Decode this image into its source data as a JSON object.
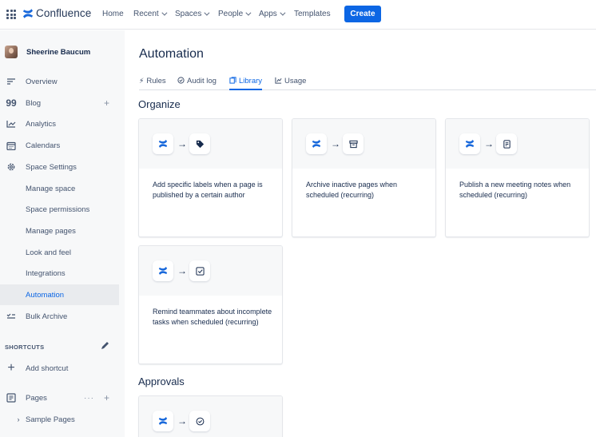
{
  "topnav": {
    "logo_text": "Confluence",
    "items": [
      "Home",
      "Recent",
      "Spaces",
      "People",
      "Apps",
      "Templates"
    ],
    "create_label": "Create"
  },
  "sidebar": {
    "user_name": "Sheerine Baucum",
    "items": [
      {
        "label": "Overview",
        "icon": "overview-icon"
      },
      {
        "label": "Blog",
        "icon": "quote-icon"
      },
      {
        "label": "Analytics",
        "icon": "analytics-icon"
      },
      {
        "label": "Calendars",
        "icon": "calendar-icon"
      },
      {
        "label": "Space Settings",
        "icon": "gear-icon"
      },
      {
        "label": "Manage space"
      },
      {
        "label": "Space permissions"
      },
      {
        "label": "Manage pages"
      },
      {
        "label": "Look and feel"
      },
      {
        "label": "Integrations"
      },
      {
        "label": "Automation"
      },
      {
        "label": "Bulk Archive",
        "icon": "bulk-archive-icon"
      }
    ],
    "shortcuts_label": "SHORTCUTS",
    "add_shortcut": "Add shortcut",
    "pages_label": "Pages",
    "sample_pages": "Sample Pages"
  },
  "main": {
    "title": "Automation",
    "tabs": [
      {
        "label": "Rules",
        "icon": "bolt-icon"
      },
      {
        "label": "Audit log",
        "icon": "check-circle-icon"
      },
      {
        "label": "Library",
        "icon": "library-icon"
      },
      {
        "label": "Usage",
        "icon": "chart-icon"
      }
    ],
    "sections": {
      "organize": "Organize",
      "approvals": "Approvals"
    },
    "cards": [
      {
        "text": "Add specific labels when a page is published by a certain author",
        "icon": "tag-icon"
      },
      {
        "text": "Archive inactive pages when scheduled (recurring)",
        "icon": "archive-icon"
      },
      {
        "text": "Publish a new meeting notes when scheduled (recurring)",
        "icon": "document-icon"
      },
      {
        "text": "Remind teammates about incomplete tasks when scheduled (recurring)",
        "icon": "checkbox-icon"
      },
      {
        "text": "",
        "icon": "check-circle-icon"
      }
    ]
  },
  "colors": {
    "accent": "#0c66e4",
    "sidebar_bg": "#f7f8f9",
    "active_bg": "#e9ebee"
  }
}
